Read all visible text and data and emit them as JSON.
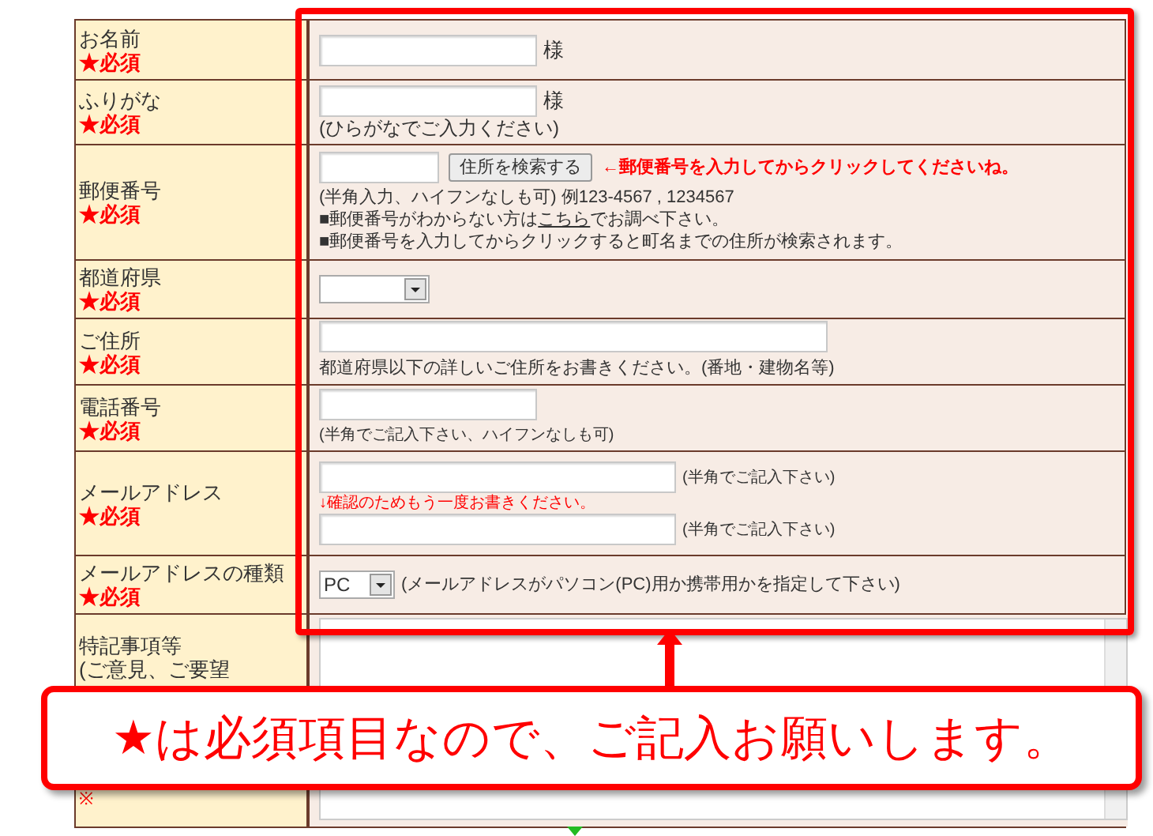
{
  "form": {
    "rows": [
      {
        "kind": "name",
        "label": "お名前",
        "required_mark": "★必須",
        "suffix": "様"
      },
      {
        "kind": "furigana",
        "label": "ふりがな",
        "required_mark": "★必須",
        "suffix": "様",
        "note": "(ひらがなでご入力ください)"
      },
      {
        "kind": "postal",
        "label": "郵便番号",
        "required_mark": "★必須",
        "button": "住所を検索する",
        "hint": "←郵便番号を入力してからクリックしてくださいね。",
        "format_note": "(半角入力、ハイフンなしも可) 例123-4567 , 1234567",
        "lookup_before": "■郵便番号がわからない方は",
        "lookup_link": "こちら",
        "lookup_after": "でお調べ下さい。",
        "search_note": "■郵便番号を入力してからクリックすると町名までの住所が検索されます。"
      },
      {
        "kind": "select",
        "label": "都道府県",
        "required_mark": "★必須"
      },
      {
        "kind": "address",
        "label": "ご住所",
        "required_mark": "★必須",
        "note": "都道府県以下の詳しいご住所をお書きください。(番地・建物名等)"
      },
      {
        "kind": "tel",
        "label": "電話番号",
        "required_mark": "★必須",
        "note": "(半角でご記入下さい、ハイフンなしも可)"
      },
      {
        "kind": "email",
        "label": "メールアドレス",
        "required_mark": "★必須",
        "note": "(半角でご記入下さい)",
        "confirm_hint": "↓確認のためもう一度お書きください。",
        "confirm_note": "(半角でご記入下さい)"
      },
      {
        "kind": "select_value",
        "label": "メールアドレスの種類",
        "required_mark": "★必須",
        "value": "PC",
        "note": "(メールアドレスがパソコン(PC)用か携帯用かを指定して下さい)"
      },
      {
        "kind": "textarea",
        "label_lines": [
          "特記事項等",
          "(ご意見、ご要望"
        ],
        "red_note": "※"
      }
    ]
  },
  "callout": {
    "text": "★は必須項目なので、ご記入お願いします。"
  }
}
